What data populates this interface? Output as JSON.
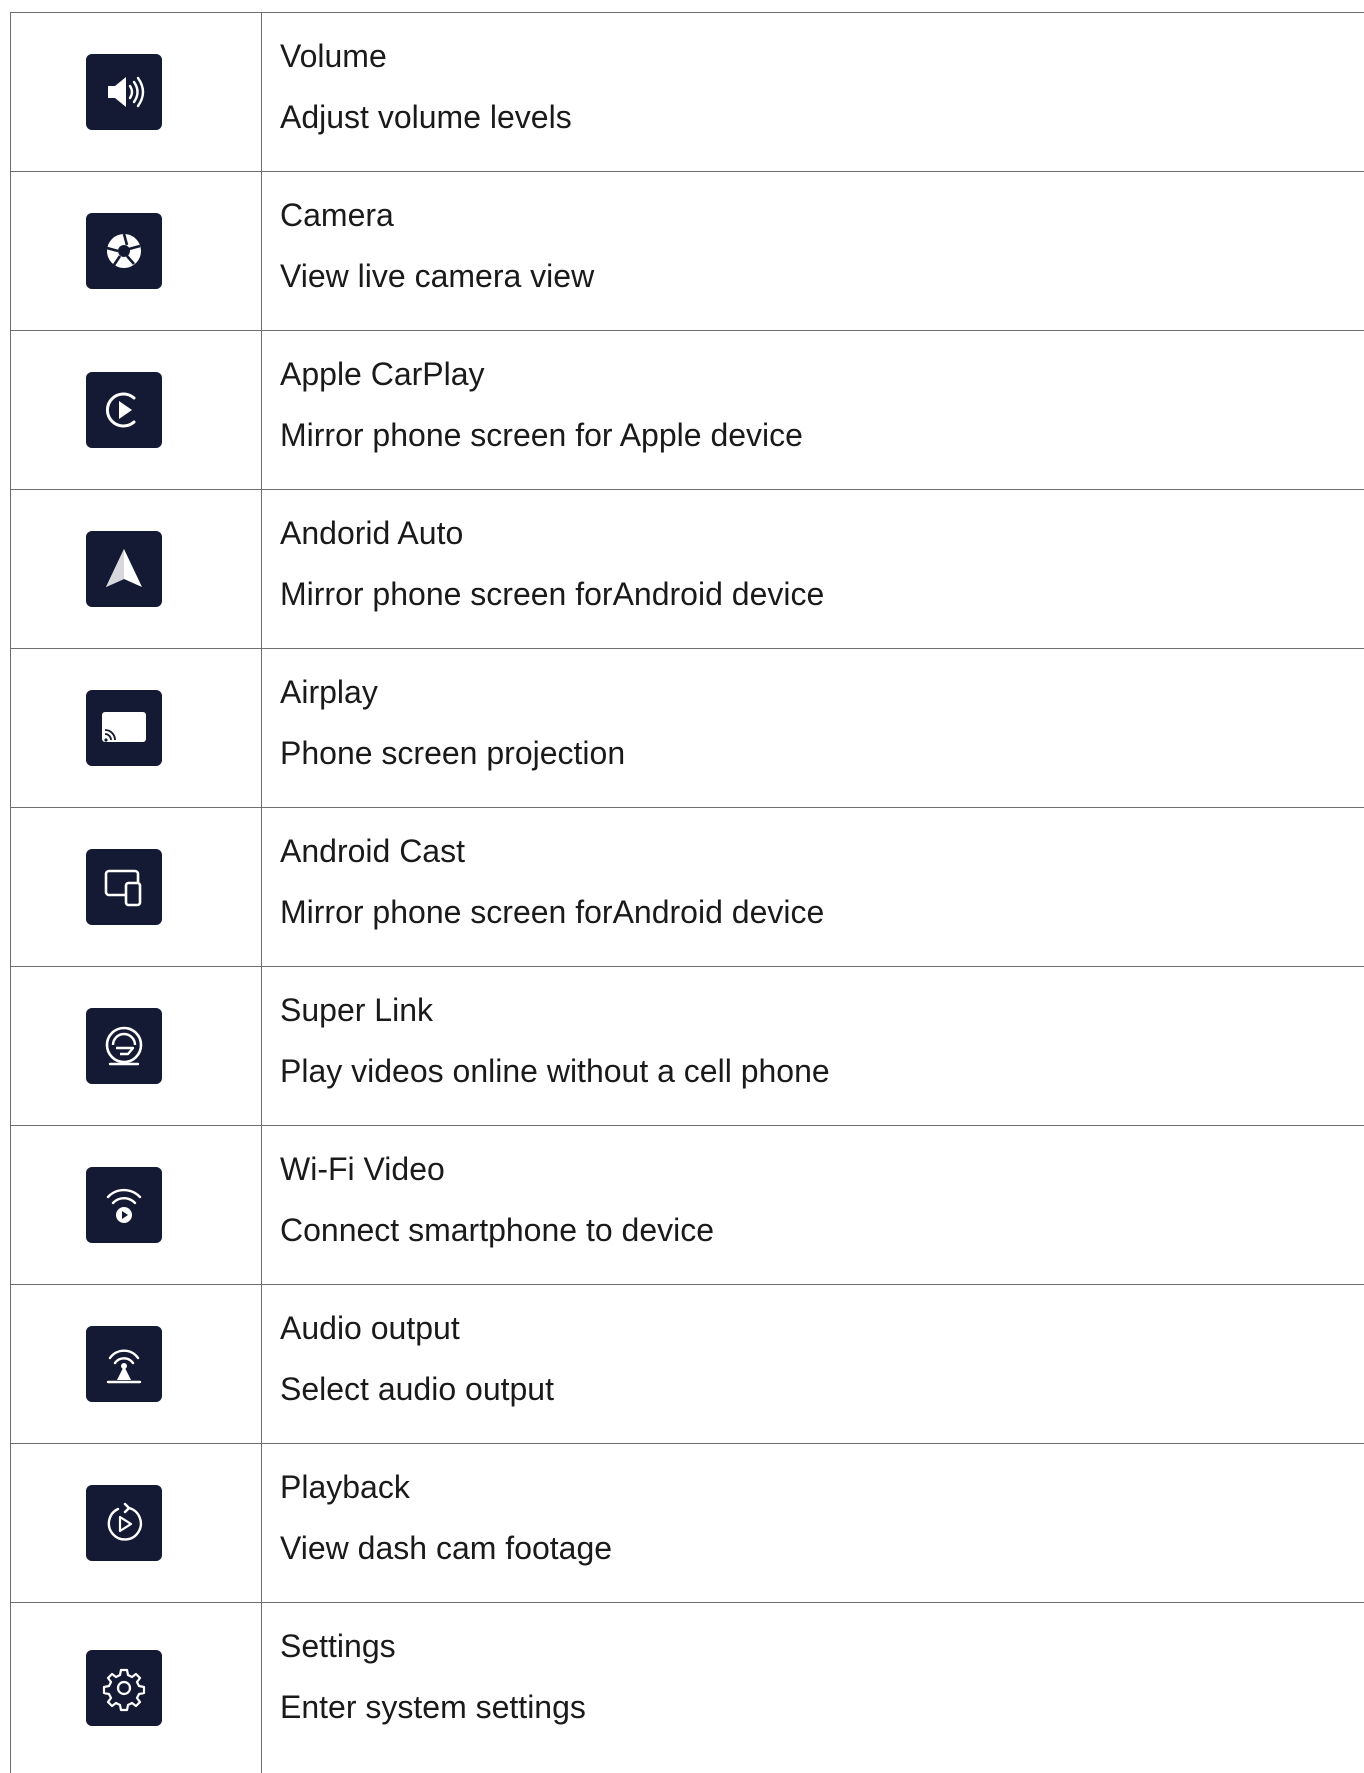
{
  "rows": [
    {
      "icon": "volume-icon",
      "title": "Volume",
      "desc": "Adjust volume levels"
    },
    {
      "icon": "camera-aperture-icon",
      "title": "Camera",
      "desc": "View live camera view"
    },
    {
      "icon": "carplay-icon",
      "title": "Apple CarPlay",
      "desc": "Mirror phone screen for Apple device"
    },
    {
      "icon": "android-auto-icon",
      "title": "Andorid Auto",
      "desc": "Mirror phone screen forAndroid device"
    },
    {
      "icon": "airplay-icon",
      "title": "Airplay",
      "desc": "Phone screen projection"
    },
    {
      "icon": "android-cast-icon",
      "title": "Android Cast",
      "desc": "Mirror phone screen forAndroid device"
    },
    {
      "icon": "super-link-icon",
      "title": "Super Link",
      "desc": "Play videos online without a cell phone"
    },
    {
      "icon": "wifi-video-icon",
      "title": "Wi-Fi Video",
      "desc": "Connect smartphone to device"
    },
    {
      "icon": "audio-output-icon",
      "title": "Audio output",
      "desc": "Select audio output"
    },
    {
      "icon": "playback-icon",
      "title": "Playback",
      "desc": "View dash cam footage"
    },
    {
      "icon": "settings-gear-icon",
      "title": "Settings",
      "desc": "Enter system settings"
    }
  ],
  "colors": {
    "icon_bg": "#141a33",
    "icon_fg": "#ffffff",
    "border": "#6e6e6e",
    "text": "#1a1a1a"
  }
}
